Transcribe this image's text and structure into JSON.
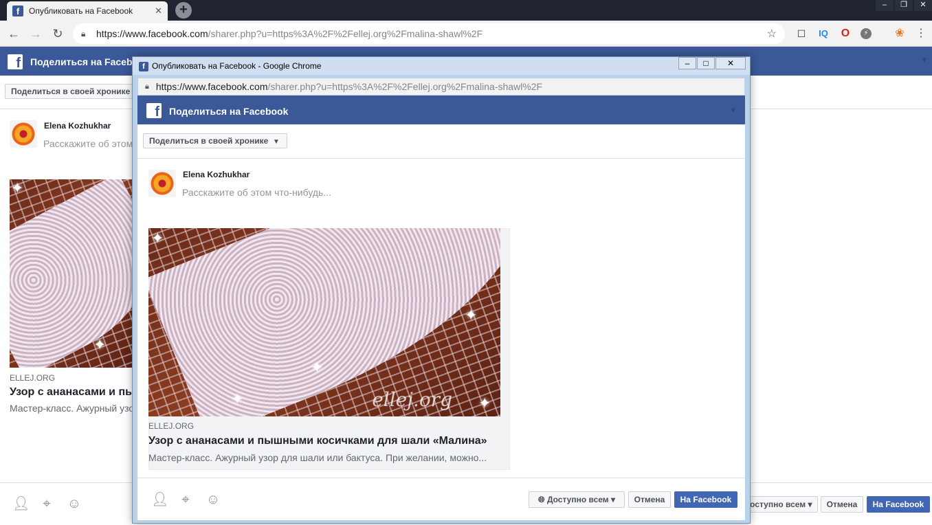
{
  "browser": {
    "tab_title": "Опубликовать на Facebook",
    "tab_close": "✕",
    "new_tab": "+",
    "url_host": "https://www.facebook.com",
    "url_path": "/sharer.php?u=https%3A%2F%2Fellej.org%2Fmalina-shawl%2F",
    "window_controls": [
      "–",
      "❐",
      "✕"
    ]
  },
  "popup": {
    "window_title": "Опубликовать на Facebook - Google Chrome",
    "window_controls": [
      "–",
      "□",
      "✕"
    ],
    "url_host": "https://www.facebook.com",
    "url_path": "/sharer.php?u=https%3A%2F%2Fellej.org%2Fmalina-shawl%2F"
  },
  "share": {
    "header_title": "Поделиться на Facebook",
    "logo_letter": "f",
    "destination_select": "Поделиться в своей хронике",
    "user_name": "Elena Kozhukhar",
    "placeholder": "Расскажите об этом что-нибудь...",
    "placeholder_truncated": "Расскажите об этом",
    "link": {
      "domain": "ELLEJ.ORG",
      "headline": "Узор с ананасами и пышными косичками для шали «Малина»",
      "description": "Мастер-класс. Ажурный узор для шали или бактуса. При желании, можно...",
      "watermark": "ellej.org"
    },
    "privacy_button": "Доступно всем",
    "cancel_button": "Отмена",
    "post_button": "На Facebook"
  },
  "icons": [
    "facebook-icon",
    "back-icon",
    "forward-icon",
    "reload-icon",
    "lock-icon",
    "star-icon",
    "screenshot-icon",
    "iq-icon",
    "opera-icon",
    "flash-icon",
    "extension-flower-icon",
    "menu-icon",
    "tag-friends-icon",
    "location-icon",
    "feeling-icon",
    "globe-icon",
    "caret-down-icon"
  ],
  "colors": {
    "facebook_blue": "#3b5998",
    "button_blue": "#4267b2",
    "chrome_dark": "#1f2430"
  }
}
